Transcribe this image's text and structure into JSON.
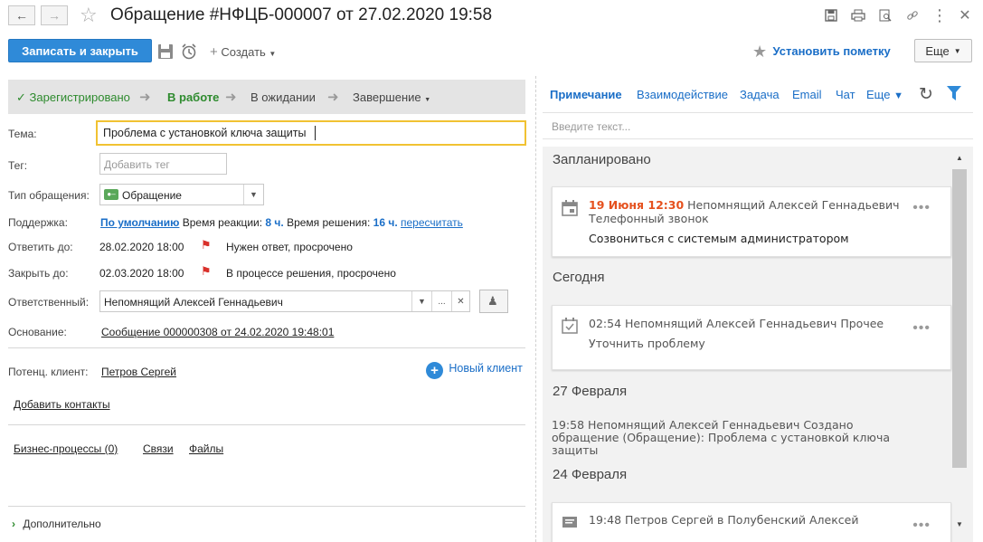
{
  "window": {
    "title": "Обращение #НФЦБ-000007 от 27.02.2020 19:58"
  },
  "toolbar": {
    "save_close": "Записать и закрыть",
    "create": "Создать",
    "set_mark": "Установить пометку",
    "more": "Еще"
  },
  "status": {
    "steps": [
      "Зарегистрировано",
      "В работе",
      "В ожидании",
      "Завершение"
    ],
    "active": "В работе"
  },
  "form": {
    "subject_label": "Тема:",
    "subject_value": "Проблема с установкой ключа защиты",
    "tag_label": "Тег:",
    "tag_placeholder": "Добавить тег",
    "type_label": "Тип обращения:",
    "type_value": "Обращение",
    "support_label": "Поддержка:",
    "support_default": "По умолчанию",
    "reaction_label": "Время реакции:",
    "reaction_value": "8 ч.",
    "resolve_label": "Время решения:",
    "resolve_value": "16 ч.",
    "recalc": "пересчитать",
    "reply_label": "Ответить до:",
    "reply_date": "28.02.2020 18:00",
    "reply_status": "Нужен ответ, просрочено",
    "close_label": "Закрыть до:",
    "close_date": "02.03.2020 18:00",
    "close_status": "В процессе решения, просрочено",
    "resp_label": "Ответственный:",
    "resp_value": "Непомнящий Алексей Геннадьевич",
    "basis_label": "Основание:",
    "basis_value": "Сообщение 000000308 от 24.02.2020 19:48:01",
    "client_label": "Потенц. клиент:",
    "client_value": "Петров Сергей",
    "new_client": "Новый клиент",
    "add_contacts": "Добавить контакты",
    "links": [
      "Бизнес-процессы (0)",
      "Связи",
      "Файлы"
    ],
    "additional": "Дополнительно"
  },
  "right": {
    "tabs": [
      "Примечание",
      "Взаимодействие",
      "Задача",
      "Email",
      "Чат",
      "Еще"
    ],
    "note_placeholder": "Введите текст...",
    "groups": {
      "planned": "Запланировано",
      "today": "Сегодня",
      "feb27": "27 Февраля",
      "feb24": "24 Февраля"
    },
    "card1": {
      "date": "19 Июня 12:30",
      "person": "Непомнящий Алексей Геннадьевич",
      "kind": "Телефонный звонок",
      "text": "Созвониться с системым администратором"
    },
    "card2": {
      "line1": "02:54 Непомнящий Алексей Геннадьевич Прочее",
      "text": "Уточнить проблему"
    },
    "entry3": {
      "line1": "19:58 Непомнящий Алексей Геннадьевич Создано",
      "line2": "обращение (Обращение): Проблема с установкой ключа",
      "line3": "защиты"
    },
    "card4": {
      "line1": "19:48 Петров Сергей в Полубенский Алексей"
    }
  },
  "colors": {
    "accent": "#2f8ad8",
    "link": "#1a6ec7",
    "green": "#2e8b2e",
    "overdue": "#e5511e"
  }
}
